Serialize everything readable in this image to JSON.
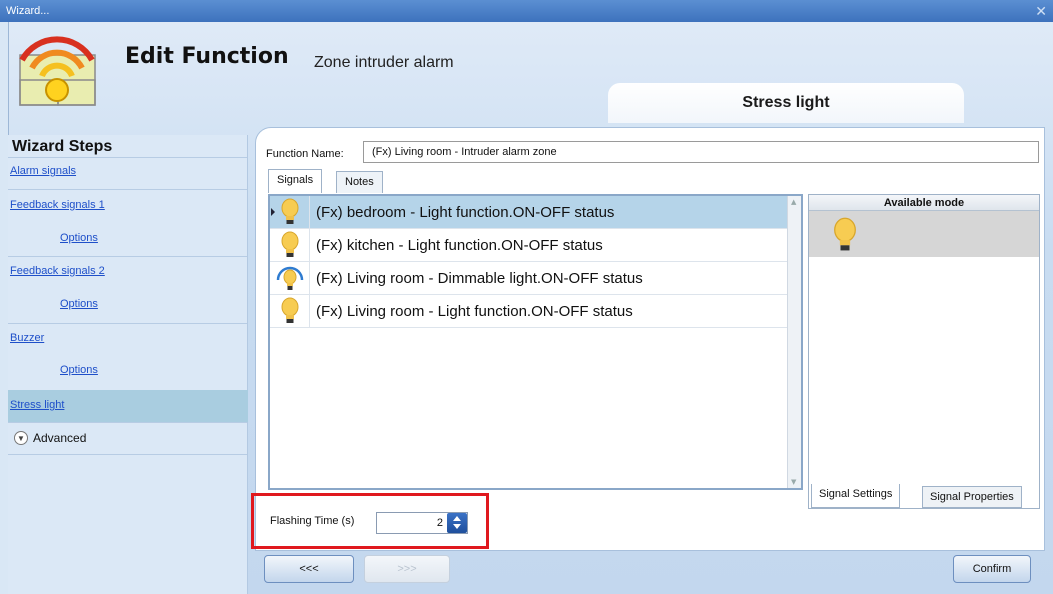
{
  "window": {
    "title": "Wizard...",
    "close_glyph": "✕"
  },
  "header": {
    "title": "Edit Function",
    "function_type": "Zone intruder alarm",
    "step_banner": "Stress light",
    "logo_icon": "zone-alarm-icon"
  },
  "sidebar": {
    "title": "Wizard Steps",
    "items": [
      {
        "label": "Alarm signals"
      },
      {
        "label": "Feedback signals 1"
      },
      {
        "label": "Options"
      },
      {
        "label": "Feedback signals 2"
      },
      {
        "label": "Options"
      },
      {
        "label": "Buzzer"
      },
      {
        "label": "Options"
      },
      {
        "label": "Stress light",
        "active": true
      }
    ],
    "advanced": "Advanced"
  },
  "form": {
    "function_name_label": "Function Name:",
    "function_name_value": "(Fx) Living room - Intruder alarm zone"
  },
  "tabs": {
    "signals": "Signals",
    "notes": "Notes"
  },
  "signals": [
    {
      "label": "(Fx) bedroom - Light function.ON-OFF status",
      "icon": "light-bulb-icon",
      "selected": true
    },
    {
      "label": "(Fx) kitchen - Light function.ON-OFF status",
      "icon": "light-bulb-icon"
    },
    {
      "label": "(Fx) Living room - Dimmable light.ON-OFF status",
      "icon": "dimmable-bulb-icon"
    },
    {
      "label": "(Fx) Living room - Light function.ON-OFF status",
      "icon": "light-bulb-icon"
    }
  ],
  "available_mode": {
    "title": "Available mode",
    "icon": "light-bulb-icon",
    "tab_signal_settings": "Signal Settings",
    "tab_signal_properties": "Signal Properties"
  },
  "flashing": {
    "label": "Flashing Time (s)",
    "value": "2"
  },
  "buttons": {
    "prev": "<<<",
    "next": ">>>",
    "confirm": "Confirm"
  },
  "colors": {
    "highlight_box": "#e0181e",
    "selected_row": "#b5d4e9",
    "link": "#1e4fc9"
  }
}
